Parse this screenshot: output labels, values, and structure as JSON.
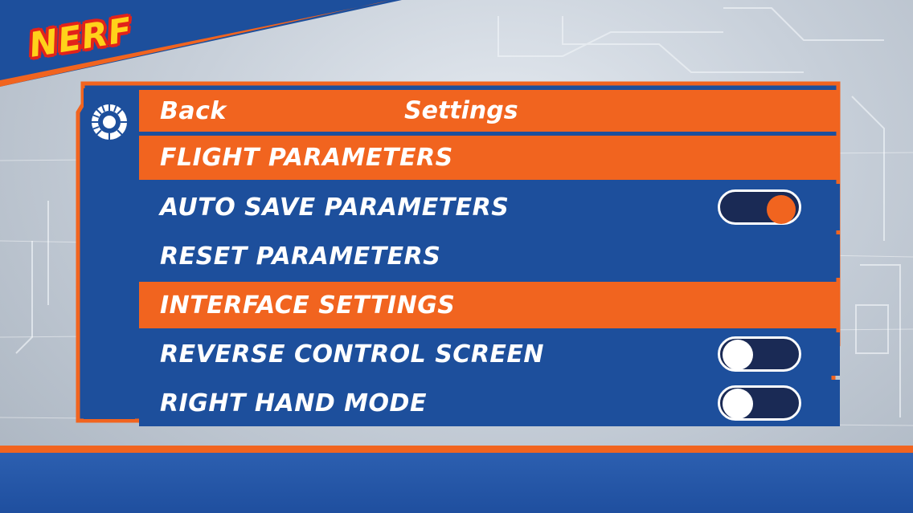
{
  "brand": {
    "logo_text": "NERF"
  },
  "header": {
    "back_label": "Back",
    "title": "Settings"
  },
  "sections": {
    "flight": {
      "label": "FLIGHT PARAMETERS"
    },
    "interface": {
      "label": "INTERFACE SETTINGS"
    }
  },
  "settings": {
    "auto_save": {
      "label": "AUTO SAVE PARAMETERS",
      "enabled": true
    },
    "reset": {
      "label": "RESET PARAMETERS"
    },
    "reverse_control": {
      "label": "REVERSE CONTROL SCREEN",
      "enabled": false
    },
    "right_hand": {
      "label": "RIGHT HAND MODE",
      "enabled": false
    }
  },
  "colors": {
    "orange": "#f1641f",
    "blue": "#1d4f9c",
    "toggle_track": "#1a2a55",
    "logo_yellow": "#ffd21a",
    "logo_red": "#e2231a"
  },
  "icons": {
    "panel_badge": "gear-icon"
  }
}
